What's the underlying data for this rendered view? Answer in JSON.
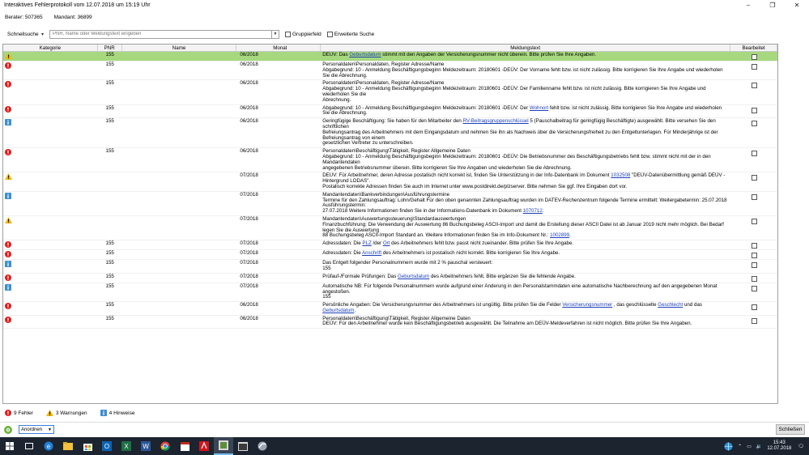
{
  "window": {
    "title": "Interaktives Fehlerprotokoll vom 12.07.2018 um 15:19 Uhr"
  },
  "info": {
    "berater": "Berater: 507365",
    "mandant": "Mandant: 36899"
  },
  "search": {
    "label": "Schnellsuche",
    "placeholder": "PNR, Name oder Meldungstext eingeben",
    "group_label": "Gruppierfeld",
    "extended_label": "Erweiterte Suche"
  },
  "columns": {
    "kategorie": "Kategorie",
    "pnr": "PNR",
    "name": "Name",
    "monat": "Monat",
    "meldungstext": "Meldungstext",
    "bearbeitet": "Bearbeitet"
  },
  "colors": {
    "error": "#e21a1a",
    "warning": "#f2b705",
    "info": "#3d8fd1",
    "selected_row": "#a7d87f",
    "link": "#1c3fb8"
  },
  "rows": [
    {
      "type": "warning",
      "icon": "warning-icon",
      "pnr": "155",
      "monat": "06/2018",
      "lines": [
        [
          "DEÜV: Das ",
          {
            "link": "Geburtsdatum"
          },
          " stimmt mit den Angaben der Versicherungsnummer nicht überein. Bitte prüfen Sie Ihre Angaben."
        ]
      ],
      "selected": true
    },
    {
      "type": "error",
      "icon": "error-icon",
      "pnr": "155",
      "monat": "06/2018",
      "lines": [
        [
          "Personaldaten\\Personaldaten, Register Adresse/Name"
        ],
        [
          "Abgabegrund: 10 - Anmeldung Beschäftigungsbeginn Meldezeitraum: 20180601 -DEÜV: Der Vorname fehlt bzw. ist nicht zulässig. Bitte korrigieren Sie Ihre Angabe und wiederholen Sie die Abrechnung."
        ]
      ]
    },
    {
      "type": "error",
      "icon": "error-icon",
      "pnr": "155",
      "monat": "06/2018",
      "lines": [
        [
          "Personaldaten\\Personaldaten, Register Adresse/Name"
        ],
        [
          "Abgabegrund: 10 - Anmeldung Beschäftigungsbeginn Meldezeitraum: 20180601 -DEÜV: Der Familienname fehlt bzw. ist nicht zulässig. Bitte korrigieren Sie Ihre Angabe und wiederholen Sie die"
        ],
        [
          "Abrechnung."
        ]
      ]
    },
    {
      "type": "error",
      "icon": "error-icon",
      "pnr": "155",
      "monat": "06/2018",
      "lines": [
        [
          "Abgabegrund: 10 - Anmeldung Beschäftigungsbeginn Meldezeitraum: 20180601 -DEÜV: Der ",
          {
            "link": "Wohnort"
          },
          " fehlt bzw. ist nicht zulässig. Bitte korrigieren Sie Ihre Angabe und wiederholen Sie die Abrechnung."
        ]
      ]
    },
    {
      "type": "info",
      "icon": "info-icon",
      "pnr": "155",
      "monat": "06/2018",
      "lines": [
        [
          "Geringfügige Beschäftigung: Sie haben für den Mitarbeiter den ",
          {
            "link": "RV-Beitragsgruppenschlüssel"
          },
          " 5 (Pauschalbeitrag für geringfügig Beschäftigte) ausgewählt. Bitte versehen Sie den schriftlichen"
        ],
        [
          "Befreiungsantrag des Arbeitnehmers mit dem Eingangsdatum und nehmen Sie ihn als Nachweis über die Versicherungsfreiheit zu den Entgeltunterlagen. Für Minderjährige ist der Befreiungsantrag von einem"
        ],
        [
          "gesetzlichen Vertreter zu unterschreiben."
        ]
      ]
    },
    {
      "type": "error",
      "icon": "error-icon",
      "pnr": "155",
      "monat": "06/2018",
      "lines": [
        [
          "Personaldaten\\Beschäftigung\\Tätigkeit, Register Allgemeine Daten"
        ],
        [
          "Abgabegrund: 10 - Anmeldung Beschäftigungsbeginn Meldezeitraum: 20180601 -DEÜV: Die Betriebsnummer des Beschäftigungsbetriebs fehlt bzw. stimmt nicht mit der in den Mandantendaten"
        ],
        [
          "angegebenen Betriebsnummer überein. Bitte korrigieren Sie Ihre Angaben und wiederholen Sie die Abrechnung."
        ]
      ]
    },
    {
      "type": "warning",
      "icon": "warning-icon",
      "pnr": "",
      "monat": "07/2018",
      "lines": [
        [
          "DEÜV: Für Arbeitnehmer, deren Adresse postalisch nicht korrekt ist, finden Sie Unterstützung in der Info-Datenbank im Dokument ",
          {
            "link": "1032508"
          },
          " \"DEÜV-Datenübermittlung gemäß DEÜV - Hintergrund LODAS\"."
        ],
        [
          "Postalisch korrekte Adressen finden Sie auch im Internet unter www.postdirekt.de/plzserver. Bitte nehmen Sie ggf. Ihre Eingaben dort vor."
        ]
      ]
    },
    {
      "type": "info",
      "icon": "info-icon",
      "pnr": "",
      "monat": "07/2018",
      "lines": [
        [
          "Mandantendaten\\Bankverbindungen\\Ausführungstermine"
        ],
        [
          "Termine für den Zahlungsauftrag: Lohn/Gehalt Für den oben genannten Zahlungsauftrag wurden im DATEV-Rechenzentrum folgende Termine ermittelt: Weitergabetermin: 25.07.2018 Ausführungstermin:"
        ],
        [
          "27.07.2018 Weitere Informationen finden Sie in der Informations-Datenbank im Dokument ",
          {
            "link": "1070712"
          },
          "."
        ]
      ]
    },
    {
      "type": "warning",
      "icon": "warning-icon",
      "pnr": "",
      "monat": "07/2018",
      "lines": [
        [
          "Mandantendaten\\Auswertungssteuerung\\Standardauswertungen"
        ],
        [
          "Finanzbuchführung: Die Verwendung der Auswertung 86 Buchungsbeleg ASCII-Import und damit die Erstellung dieser ASCII Datei ist ab Januar 2019 nicht mehr möglich. Bei Bedarf legen Sie die Auswertung"
        ],
        [
          "88 Buchungsbeleg ASCII-Import Standard an. Weitere Informationen finden Sie im Info-Dokument Nr.: ",
          {
            "link": "1002899"
          },
          "."
        ]
      ]
    },
    {
      "type": "error",
      "icon": "error-icon",
      "pnr": "155",
      "monat": "07/2018",
      "lines": [
        [
          "Adressdaten: Die ",
          {
            "link": "PLZ"
          },
          " /der ",
          {
            "link": "Ort"
          },
          " des Arbeitnehmers fehlt bzw. passt nicht zueinander. Bitte prüfen Sie Ihre Angabe."
        ]
      ]
    },
    {
      "type": "error",
      "icon": "error-icon",
      "pnr": "155",
      "monat": "07/2018",
      "lines": [
        [
          "Adressdaten: Die ",
          {
            "link": "Anschrift"
          },
          " des Arbeitnehmers ist postalisch nicht korrekt. Bitte korrigieren Sie Ihre Angabe."
        ]
      ]
    },
    {
      "type": "info",
      "icon": "info-icon",
      "pnr": "155",
      "monat": "07/2018",
      "lines": [
        [
          "Das Entgelt folgender Personalnummern wurde mit 2 % pauschal versteuert:"
        ],
        [
          "155"
        ]
      ]
    },
    {
      "type": "error",
      "icon": "error-icon",
      "pnr": "155",
      "monat": "07/2018",
      "lines": [
        [
          "Prüfauf-/Formale Prüfungen: Das ",
          {
            "link": "Geburtsdatum"
          },
          " des Arbeitnehmers fehlt. Bitte ergänzen Sie die fehlende Angabe."
        ]
      ]
    },
    {
      "type": "info",
      "icon": "info-icon",
      "pnr": "155",
      "monat": "07/2018",
      "lines": [
        [
          "Automatische NB: Für folgende Personalnummern wurde aufgrund einer Änderung in den Personalstammdaten eine automatische Nachberechnung auf den angegebenen Monat angestoßen."
        ],
        [
          "155"
        ]
      ]
    },
    {
      "type": "error",
      "icon": "error-icon",
      "pnr": "155",
      "monat": "06/2018",
      "lines": [
        [
          "Persönliche Angaben: Die Versicherungsnummer des Arbeitnehmers ist ungültig. Bitte prüfen Sie die Felder ",
          {
            "link": "Versicherungsnummer"
          },
          " , das geschlüsselte ",
          {
            "link": "Geschlecht"
          },
          " und das ",
          {
            "link": "Geburtsdatum"
          },
          "."
        ]
      ]
    },
    {
      "type": "error",
      "icon": "error-icon",
      "pnr": "155",
      "monat": "06/2018",
      "lines": [
        [
          "Personaldaten\\Beschäftigung\\Tätigkeit, Register Allgemeine Daten"
        ],
        [
          "DEÜV: Für den Arbeitnehmer wurde kein Beschäftigungsbetrieb ausgewählt. Die Teilnahme am DEÜV-Meldeverfahren ist nicht möglich. Bitte prüfen Sie Ihre Angaben."
        ]
      ]
    }
  ],
  "summary": {
    "errors": "9 Fehler",
    "warnings": "3 Warnungen",
    "hints": "4 Hinweise"
  },
  "footer": {
    "arrange_value": "Anordnen",
    "close_label": "Schließen"
  },
  "taskbar": {
    "icons": [
      "windows-start-icon",
      "edge-icon",
      "file-explorer-icon",
      "store-icon",
      "outlook-icon",
      "excel-icon",
      "word-icon",
      "chrome-icon",
      "calendar-app-icon",
      "acrobat-icon",
      "datev-lodas-icon",
      "terminal-icon",
      "datev-arbeitsplatz-icon"
    ],
    "time": "15:43",
    "date": "12.07.2018"
  }
}
